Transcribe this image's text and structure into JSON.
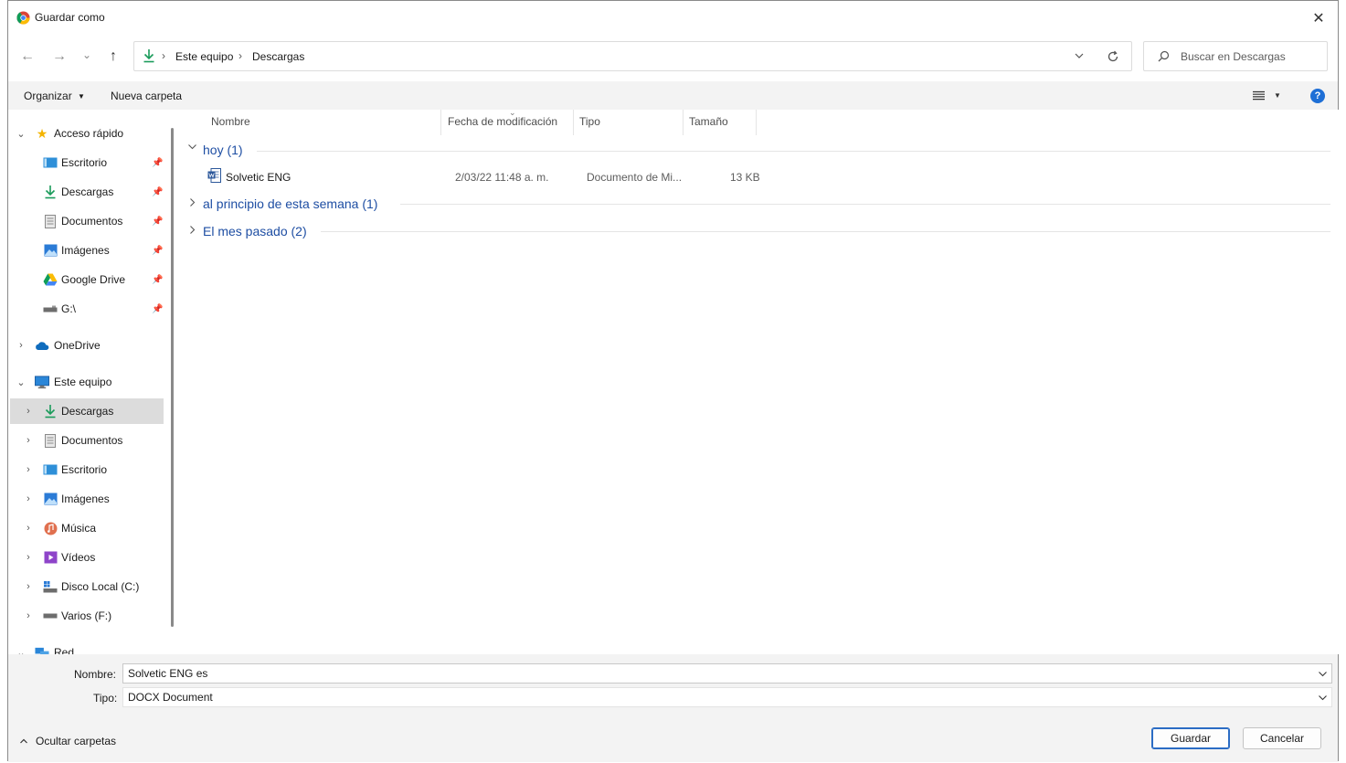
{
  "window": {
    "title": "Guardar como",
    "close_label": "✕"
  },
  "nav": {
    "back_label": "←",
    "forward_label": "→",
    "recent_label": "⌄",
    "up_label": "↑",
    "breadcrumbs": [
      "Este equipo",
      "Descargas"
    ],
    "search_placeholder": "Buscar en Descargas"
  },
  "toolbar": {
    "organize_label": "Organizar",
    "new_folder_label": "Nueva carpeta",
    "help_label": "?"
  },
  "sidebar": {
    "quick_access": "Acceso rápido",
    "quick_items": [
      "Escritorio",
      "Descargas",
      "Documentos",
      "Imágenes",
      "Google Drive",
      "G:\\"
    ],
    "onedrive": "OneDrive",
    "this_pc": "Este equipo",
    "pc_items": [
      "Descargas",
      "Documentos",
      "Escritorio",
      "Imágenes",
      "Música",
      "Vídeos",
      "Disco Local (C:)",
      "Varios (F:)"
    ],
    "network": "Red"
  },
  "columns": {
    "name": "Nombre",
    "date": "Fecha de modificación",
    "type": "Tipo",
    "size": "Tamaño"
  },
  "groups": [
    {
      "title": "hoy (1)",
      "expanded": true
    },
    {
      "title": "al principio de esta semana (1)",
      "expanded": false
    },
    {
      "title": "El mes pasado (2)",
      "expanded": false
    }
  ],
  "files": [
    {
      "name": "Solvetic ENG",
      "date": "2/03/22 11:48 a. m.",
      "type": "Documento de Mi...",
      "size": "13 KB"
    }
  ],
  "form": {
    "name_label": "Nombre:",
    "name_value": "Solvetic ENG es",
    "type_label": "Tipo:",
    "type_value": "DOCX Document"
  },
  "footer": {
    "hide_folders_label": "Ocultar carpetas",
    "save_label": "Guardar",
    "cancel_label": "Cancelar"
  },
  "colors": {
    "accent": "#1e4ea3",
    "selection": "#dcdcdc",
    "download_green": "#1a9b5a"
  }
}
